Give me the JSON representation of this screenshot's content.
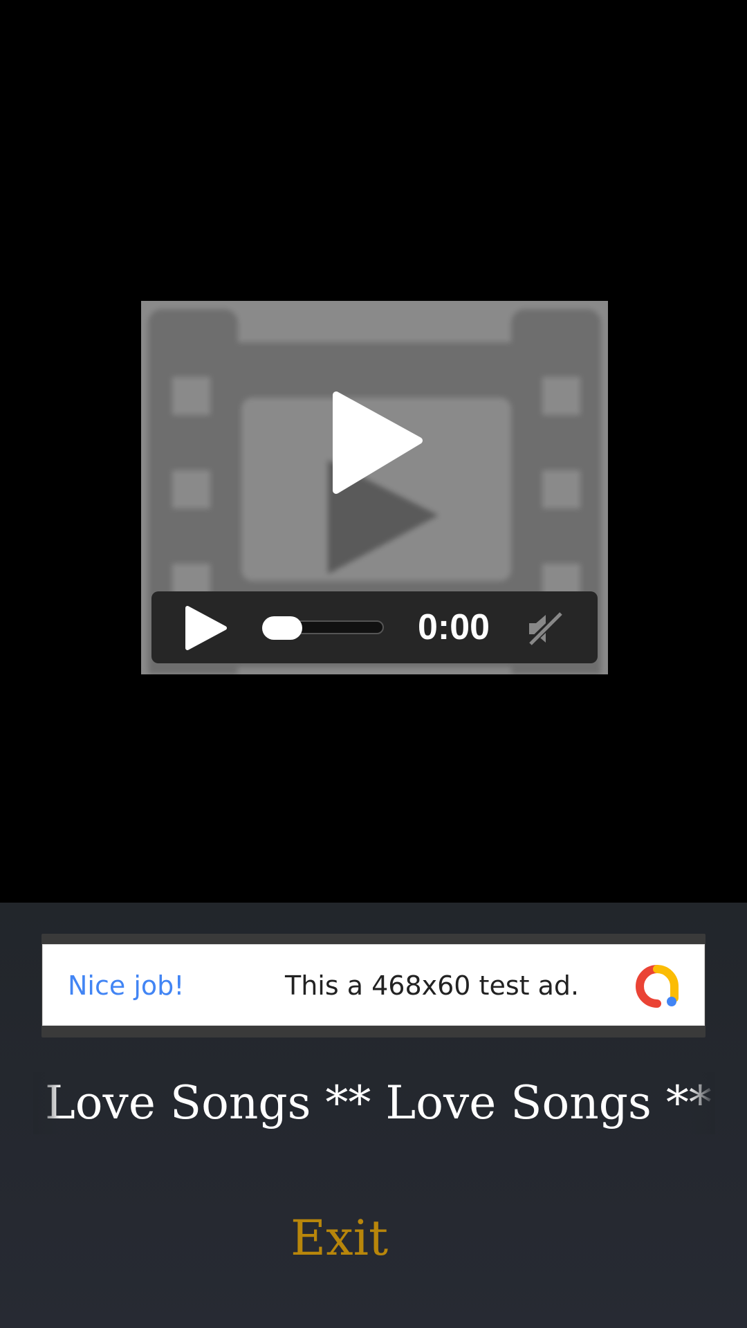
{
  "player": {
    "time": "0:00",
    "progress_fraction": 0,
    "muted": true
  },
  "ad": {
    "headline": "Nice job!",
    "text": "This a 468x60 test ad.",
    "logo_icon": "google-ads-icon"
  },
  "marquee": {
    "text": "** Love Songs  ** Love Songs  ** Love Songs"
  },
  "exit": {
    "label": "Exit"
  },
  "colors": {
    "background_top": "#000000",
    "background_bottom": "#23272d",
    "exit_color": "#b8860b",
    "ad_headline_color": "#4285f4"
  }
}
